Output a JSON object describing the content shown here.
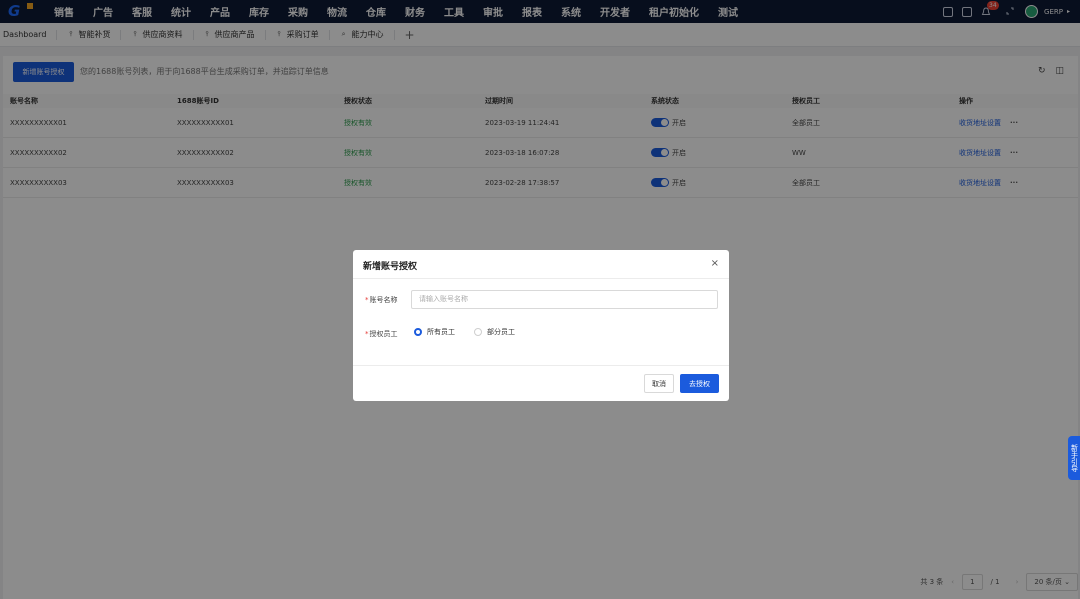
{
  "nav": {
    "items": [
      "销售",
      "广告",
      "客服",
      "统计",
      "产品",
      "库存",
      "采购",
      "物流",
      "仓库",
      "财务",
      "工具",
      "审批",
      "报表",
      "系统",
      "开发者",
      "租户初始化",
      "测试"
    ],
    "notification_count": "34",
    "username": "GERP"
  },
  "tabs": {
    "home": "Dashboard",
    "items": [
      "智能补货",
      "供应商资料",
      "供应商产品",
      "采购订单",
      "能力中心"
    ]
  },
  "toolbar": {
    "add_label": "新增账号授权",
    "description": "您的1688账号列表，用于向1688平台生成采购订单，并追踪订单信息"
  },
  "table": {
    "columns": [
      "账号名称",
      "1688账号ID",
      "授权状态",
      "过期时间",
      "系统状态",
      "授权员工",
      "操作"
    ],
    "rows": [
      {
        "name": "XXXXXXXXXX01",
        "id": "XXXXXXXXXX01",
        "auth": "授权有效",
        "expire": "2023-03-19 11:24:41",
        "status": "开启",
        "staff": "全部员工",
        "action": "收货地址设置"
      },
      {
        "name": "XXXXXXXXXX02",
        "id": "XXXXXXXXXX02",
        "auth": "授权有效",
        "expire": "2023-03-18 16:07:28",
        "status": "开启",
        "staff": "WW",
        "action": "收货地址设置"
      },
      {
        "name": "XXXXXXXXXX03",
        "id": "XXXXXXXXXX03",
        "auth": "授权有效",
        "expire": "2023-02-28 17:38:57",
        "status": "开启",
        "staff": "全部员工",
        "action": "收货地址设置"
      }
    ]
  },
  "pager": {
    "total": "共 3 条",
    "page": "1",
    "pages": "/ 1",
    "page_size": "20 条/页"
  },
  "modal": {
    "title": "新增账号授权",
    "account_label": "账号名称",
    "account_placeholder": "请输入账号名称",
    "staff_label": "授权员工",
    "option_all": "所有员工",
    "option_partial": "部分员工",
    "cancel_label": "取消",
    "confirm_label": "去授权"
  },
  "helper": {
    "text": "新手引导"
  },
  "colors": {
    "primary": "#1b5bdd",
    "nav_bg": "#0e1a36",
    "success": "#2e9d4e"
  }
}
